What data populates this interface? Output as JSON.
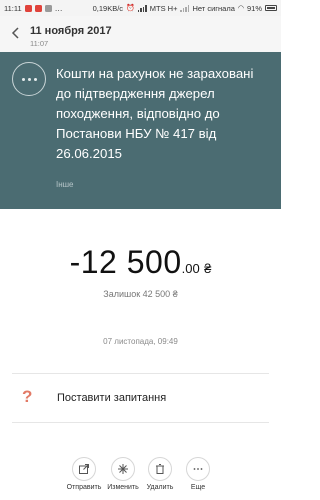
{
  "status_bar": {
    "time": "11:11",
    "speed": "0,19KB/c",
    "carrier": "MTS H+",
    "no_signal": "Нет сигнала",
    "battery": "91%"
  },
  "header": {
    "date": "11 ноября 2017",
    "time": "11:07"
  },
  "card": {
    "title": "Кошти на рахунок не зараховані до підтвердження джерел походження, відповідно до Постанови НБУ № 417 від 26.06.2015",
    "category": "Інше"
  },
  "transaction": {
    "amount_main": "-12 500",
    "amount_decimals": ".00",
    "currency": "₴",
    "balance": "Залишок 42 500 ₴",
    "datetime": "07 листопада, 09:49"
  },
  "actions": {
    "ask_question": "Поставити запитання"
  },
  "toolbar": {
    "send": "Отправить",
    "edit": "Изменить",
    "delete": "Удалить",
    "more": "Еще"
  },
  "colors": {
    "card_background": "#4b6c72",
    "ask_icon": "#e27a66"
  }
}
